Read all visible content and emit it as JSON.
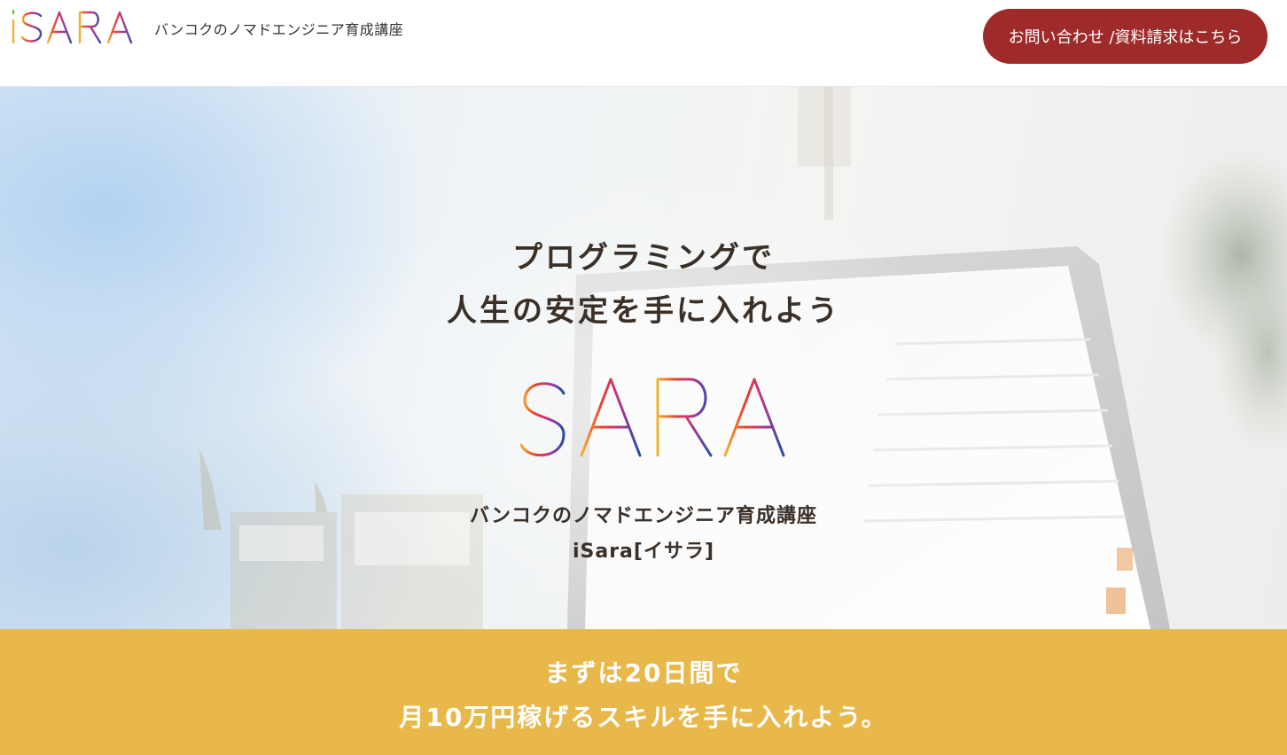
{
  "header": {
    "logo_text": "iSARA",
    "tagline": "バンコクのノマドエンジニア育成講座",
    "contact_button_label": "お問い合わせ /資料請求はこちら"
  },
  "hero": {
    "title_line1": "プログラミングで",
    "title_line2": "人生の安定を手に入れよう",
    "logo_text": "iSARA",
    "subtitle_line1": "バンコクのノマドエンジニア育成講座",
    "subtitle_line2": "iSara[イサラ]"
  },
  "banner": {
    "line1": "まずは20日間で",
    "line2": "月10万円稼げるスキルを手に入れよう。"
  },
  "colors": {
    "contact_button": "#9e2a2a",
    "banner": "#e9b84b",
    "title_text": "#3a3028"
  }
}
